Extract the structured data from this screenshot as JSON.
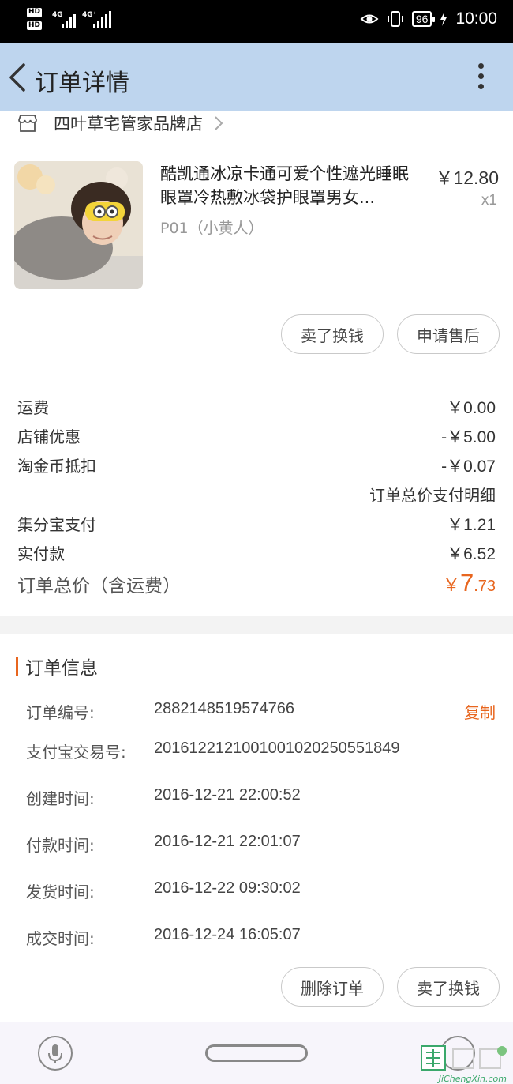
{
  "status_bar": {
    "left_badges": [
      "HD",
      "HD"
    ],
    "network_1": "4G",
    "network_2": "4G⁺",
    "battery": "96",
    "time": "10:00"
  },
  "nav": {
    "title": "订单详情",
    "back_icon": "chevron-left-icon",
    "more_icon": "more-vertical-icon"
  },
  "shop": {
    "name": "四叶草宅管家品牌店",
    "icon": "store-icon"
  },
  "product": {
    "title": "酷凯通冰凉卡通可爱个性遮光睡眠眼罩冷热敷冰袋护眼罩男女...",
    "price": "￥12.80",
    "qty": "x1",
    "sku": "P01（小黄人）"
  },
  "item_actions": {
    "sell": "卖了换钱",
    "after_sale": "申请售后"
  },
  "fees": [
    {
      "label": "运费",
      "value": "￥0.00"
    },
    {
      "label": "店铺优惠",
      "value": "-￥5.00"
    },
    {
      "label": "淘金币抵扣",
      "value": "-￥0.07"
    }
  ],
  "payment_detail_title": "订单总价支付明细",
  "payments": [
    {
      "label": "集分宝支付",
      "value": "￥1.21"
    },
    {
      "label": "实付款",
      "value": "￥6.52"
    }
  ],
  "total": {
    "label": "订单总价（含运费）",
    "currency": "￥",
    "integer": "7",
    "decimal": ".73"
  },
  "order_info": {
    "title": "订单信息",
    "copy": "复制",
    "rows": [
      {
        "k": "订单编号:",
        "v": "2882148519574766"
      },
      {
        "k": "支付宝交易号:",
        "v": "2016122121001001020250551849"
      },
      {
        "k": "创建时间:",
        "v": "2016-12-21 22:00:52"
      },
      {
        "k": "付款时间:",
        "v": "2016-12-21 22:01:07"
      },
      {
        "k": "发货时间:",
        "v": "2016-12-22 09:30:02"
      },
      {
        "k": "成交时间:",
        "v": "2016-12-24 16:05:07"
      }
    ]
  },
  "bottom_actions": {
    "delete": "删除订单",
    "sell": "卖了换钱"
  },
  "watermark": {
    "text": "JiChengXin.com"
  },
  "colors": {
    "accent": "#e8661f",
    "nav_bg": "#bed5ee"
  }
}
